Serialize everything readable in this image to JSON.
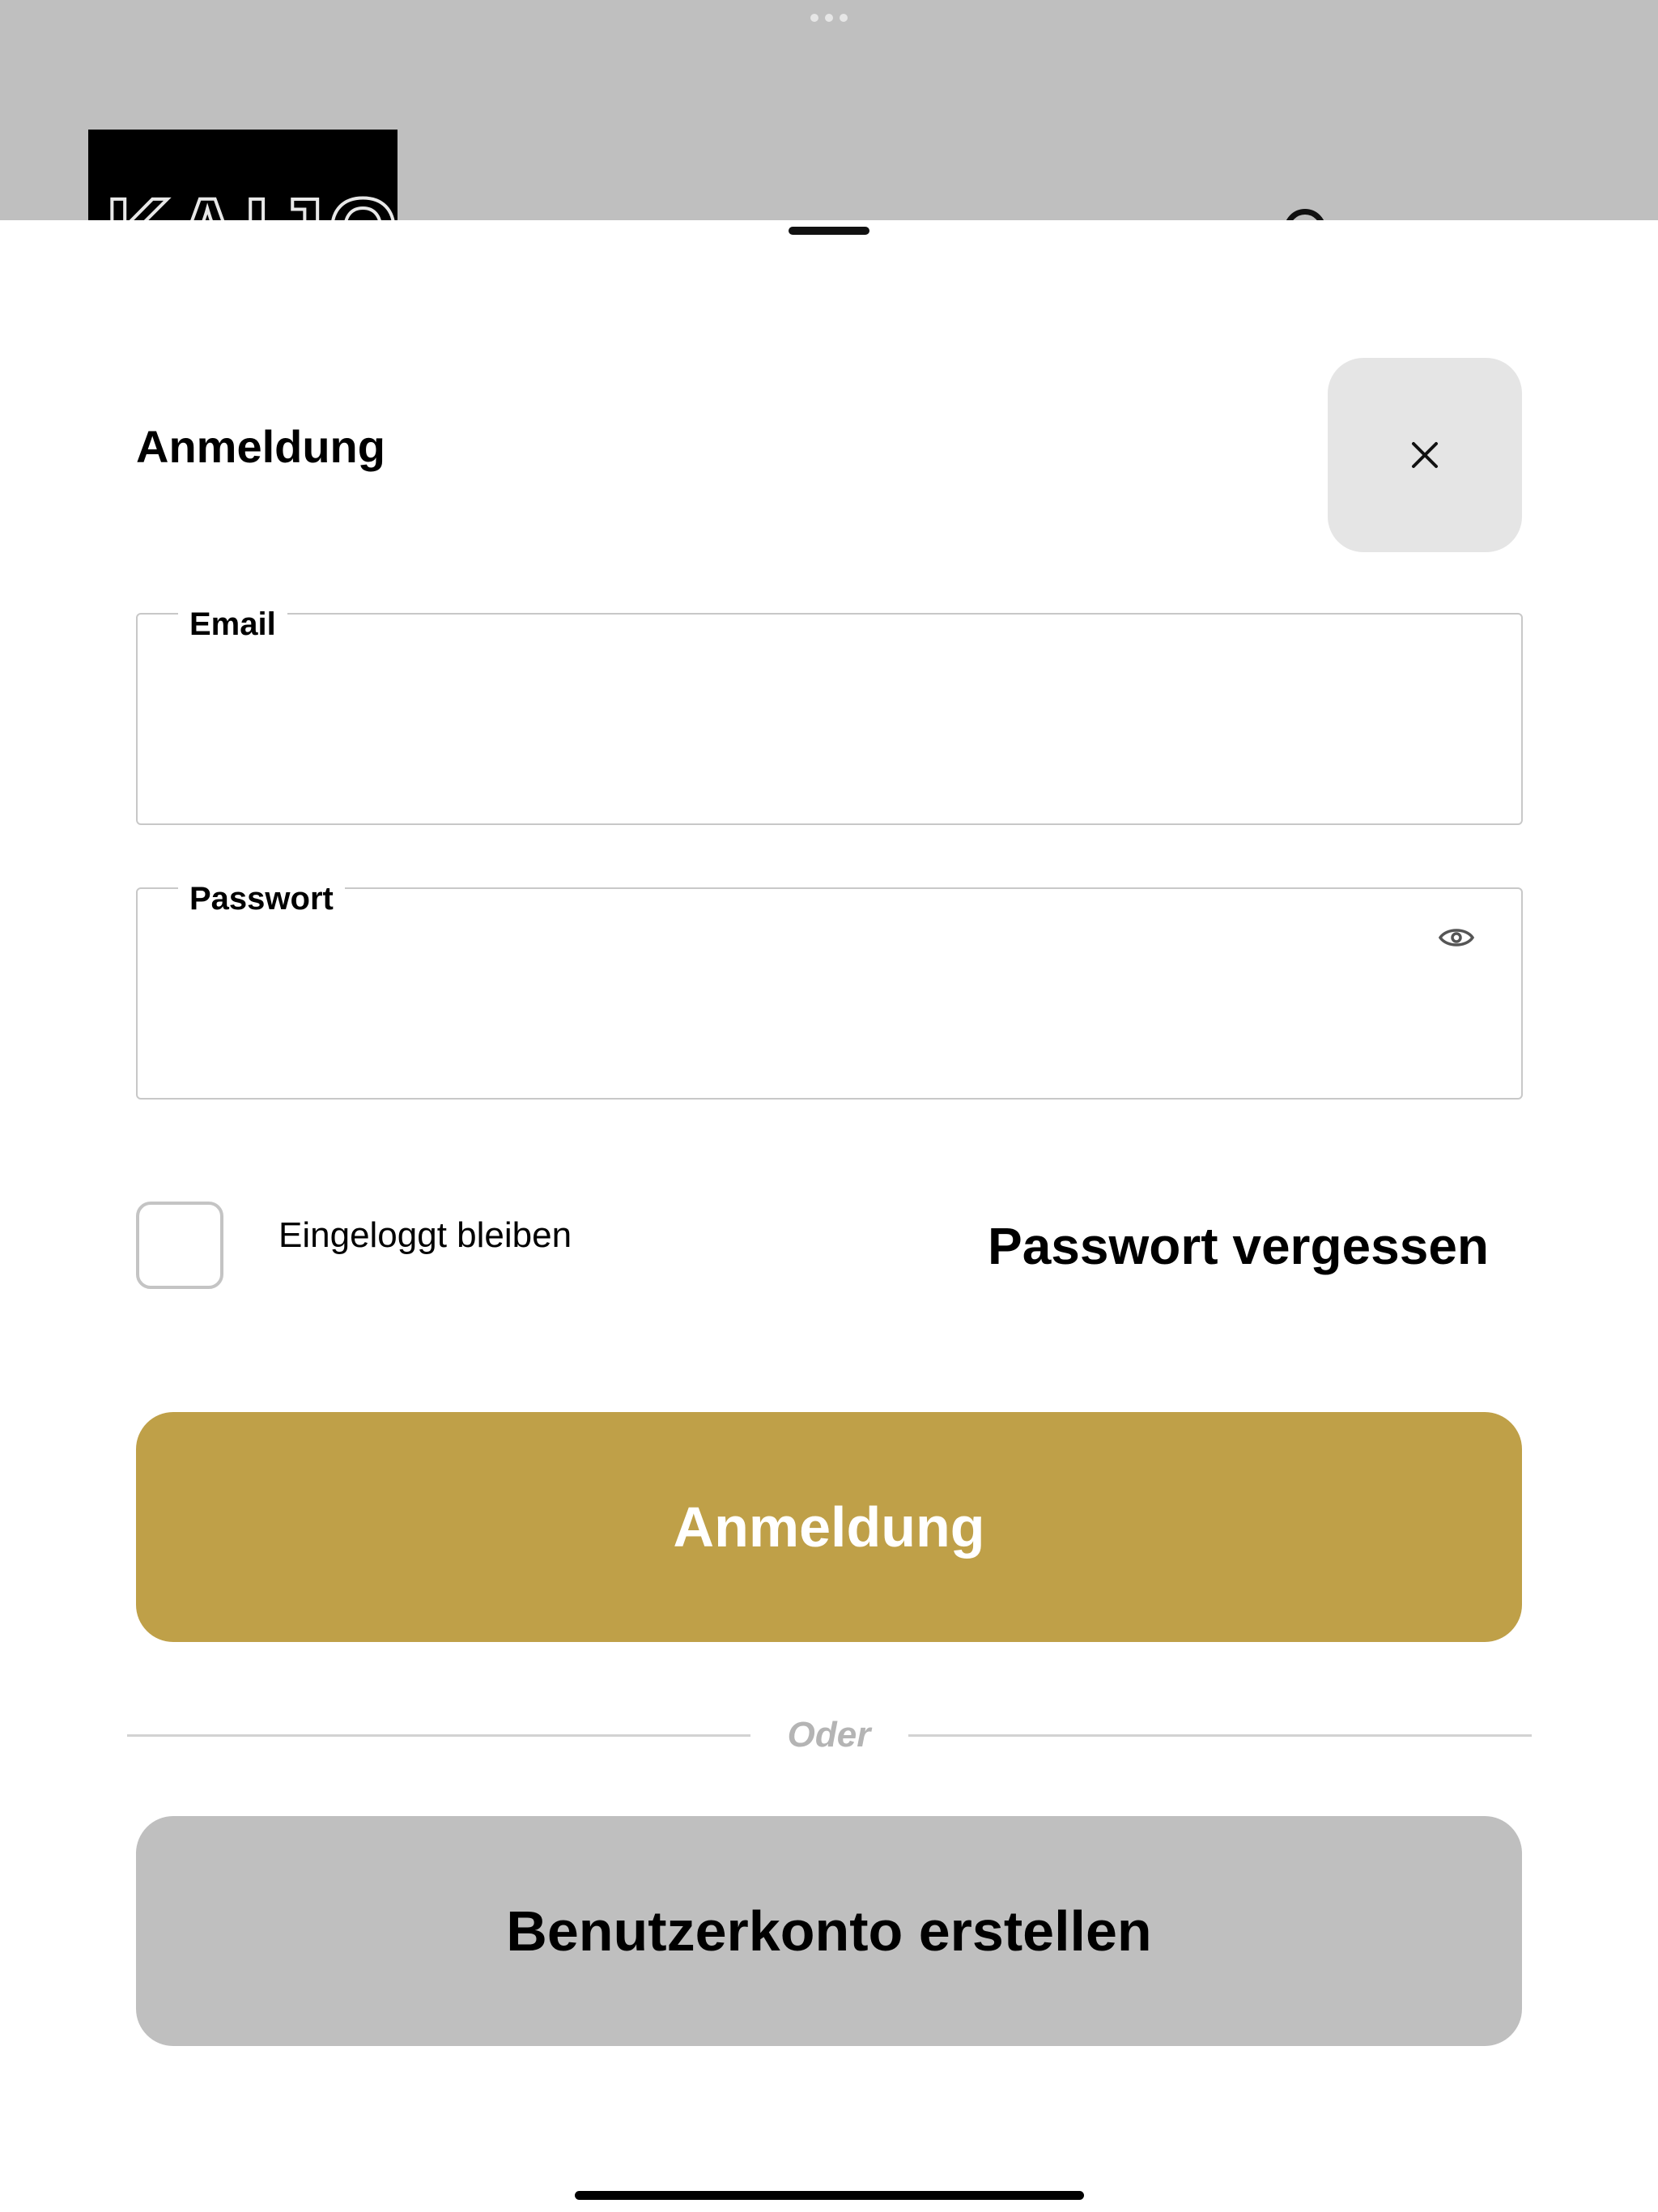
{
  "background": {
    "logo_text": "KAIJON"
  },
  "modal": {
    "title": "Anmeldung",
    "close_icon": "close-icon",
    "email_field": {
      "label": "Email",
      "value": ""
    },
    "password_field": {
      "label": "Passwort",
      "value": "",
      "toggle_icon": "eye-icon"
    },
    "remember_me": {
      "label": "Eingeloggt bleiben",
      "checked": false
    },
    "forgot_password_label": "Passwort vergessen",
    "login_button_label": "Anmeldung",
    "divider_text": "Oder",
    "register_button_label": "Benutzerkonto erstellen"
  },
  "colors": {
    "primary": "#bfa048",
    "secondary": "#bfbfbf",
    "close_bg": "#e5e5e5",
    "backdrop": "#bfbfbf"
  }
}
